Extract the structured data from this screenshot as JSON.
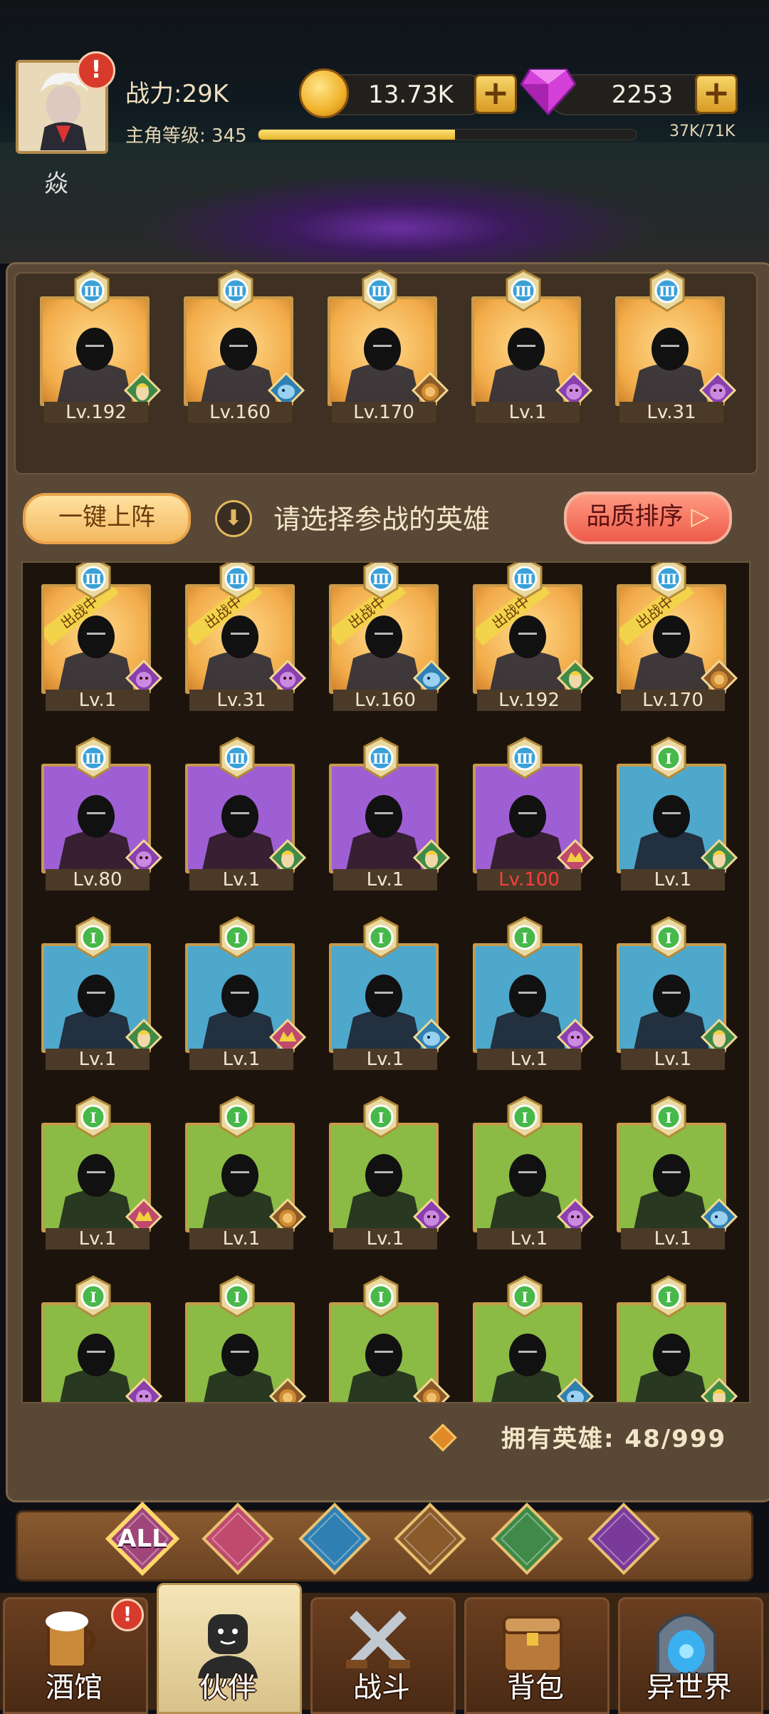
{
  "header": {
    "power": "战力:29K",
    "level_label": "主角等级: 345",
    "exp_text": "37K/71K",
    "exp_progress": 0.52,
    "coins": "13.73K",
    "gems": "2253",
    "fire_icon_text": "焱",
    "alert_mark": "!"
  },
  "team": [
    {
      "level": "Lv.192",
      "rank": "Ⅲ",
      "bg": "gold",
      "faction": "elf-icon",
      "fig": "hooded-rogue"
    },
    {
      "level": "Lv.160",
      "rank": "Ⅲ",
      "bg": "gold",
      "faction": "fish-icon",
      "fig": "mermaid"
    },
    {
      "level": "Lv.170",
      "rank": "Ⅲ",
      "bg": "gold",
      "faction": "lion-icon",
      "fig": "pharaoh"
    },
    {
      "level": "Lv.1",
      "rank": "Ⅲ",
      "bg": "gold",
      "faction": "demon-icon",
      "fig": "spiky-dark-lord"
    },
    {
      "level": "Lv.31",
      "rank": "Ⅲ",
      "bg": "gold",
      "faction": "demon-icon",
      "fig": "purple-ogre"
    }
  ],
  "actions": {
    "auto_deploy": "一键上阵",
    "hint": "请选择参战的英雄",
    "sort": "品质排序",
    "sort_arrow": "▷",
    "hint_arrow": "⬇"
  },
  "heroes": [
    {
      "level": "Lv.1",
      "rank": "Ⅲ",
      "bg": "gold",
      "faction": "demon-icon",
      "tag": "出战中"
    },
    {
      "level": "Lv.31",
      "rank": "Ⅲ",
      "bg": "gold",
      "faction": "demon-icon",
      "tag": "出战中"
    },
    {
      "level": "Lv.160",
      "rank": "Ⅲ",
      "bg": "gold",
      "faction": "fish-icon",
      "tag": "出战中"
    },
    {
      "level": "Lv.192",
      "rank": "Ⅲ",
      "bg": "gold",
      "faction": "elf-icon",
      "tag": "出战中"
    },
    {
      "level": "Lv.170",
      "rank": "Ⅲ",
      "bg": "gold",
      "faction": "lion-icon",
      "tag": "出战中"
    },
    {
      "level": "Lv.80",
      "rank": "Ⅲ",
      "bg": "purple",
      "faction": "demon-icon",
      "tag": ""
    },
    {
      "level": "Lv.1",
      "rank": "Ⅲ",
      "bg": "purple",
      "faction": "elf-icon",
      "tag": ""
    },
    {
      "level": "Lv.1",
      "rank": "Ⅲ",
      "bg": "purple",
      "faction": "elf-icon",
      "tag": ""
    },
    {
      "level": "Lv.100",
      "rank": "Ⅲ",
      "bg": "purple",
      "faction": "human-icon",
      "tag": "",
      "red": true
    },
    {
      "level": "Lv.1",
      "rank": "Ⅰ",
      "bg": "blue",
      "faction": "elf-icon",
      "tag": ""
    },
    {
      "level": "Lv.1",
      "rank": "Ⅰ",
      "bg": "blue",
      "faction": "elf-icon",
      "tag": ""
    },
    {
      "level": "Lv.1",
      "rank": "Ⅰ",
      "bg": "blue",
      "faction": "human-icon",
      "tag": ""
    },
    {
      "level": "Lv.1",
      "rank": "Ⅰ",
      "bg": "blue",
      "faction": "fish-icon",
      "tag": ""
    },
    {
      "level": "Lv.1",
      "rank": "Ⅰ",
      "bg": "blue",
      "faction": "demon-icon",
      "tag": ""
    },
    {
      "level": "Lv.1",
      "rank": "Ⅰ",
      "bg": "blue",
      "faction": "elf-icon",
      "tag": ""
    },
    {
      "level": "Lv.1",
      "rank": "Ⅰ",
      "bg": "green",
      "faction": "human-icon",
      "tag": ""
    },
    {
      "level": "Lv.1",
      "rank": "Ⅰ",
      "bg": "green",
      "faction": "lion-icon",
      "tag": ""
    },
    {
      "level": "Lv.1",
      "rank": "Ⅰ",
      "bg": "green",
      "faction": "demon-icon",
      "tag": ""
    },
    {
      "level": "Lv.1",
      "rank": "Ⅰ",
      "bg": "green",
      "faction": "demon-icon",
      "tag": ""
    },
    {
      "level": "Lv.1",
      "rank": "Ⅰ",
      "bg": "green",
      "faction": "fish-icon",
      "tag": ""
    },
    {
      "level": "",
      "rank": "Ⅰ",
      "bg": "green",
      "faction": "demon-icon",
      "tag": ""
    },
    {
      "level": "",
      "rank": "Ⅰ",
      "bg": "green",
      "faction": "lion-icon",
      "tag": ""
    },
    {
      "level": "",
      "rank": "Ⅰ",
      "bg": "green",
      "faction": "lion-icon",
      "tag": ""
    },
    {
      "level": "",
      "rank": "Ⅰ",
      "bg": "green",
      "faction": "fish-icon",
      "tag": ""
    },
    {
      "level": "",
      "rank": "Ⅰ",
      "bg": "green",
      "faction": "elf-icon",
      "tag": ""
    }
  ],
  "owned": "拥有英雄: 48/999",
  "filters": [
    {
      "name": "all-filter",
      "label": "ALL",
      "color": "#a0457a"
    },
    {
      "name": "human-filter",
      "label": "",
      "color": "#c04a6e"
    },
    {
      "name": "fish-filter",
      "label": "",
      "color": "#2f7fb2"
    },
    {
      "name": "lion-filter",
      "label": "",
      "color": "#8a5a2a"
    },
    {
      "name": "elf-filter",
      "label": "",
      "color": "#3f8a48"
    },
    {
      "name": "demon-filter",
      "label": "",
      "color": "#7a3a9a"
    }
  ],
  "nav": [
    {
      "label": "酒馆",
      "icon": "tavern-beer-icon",
      "alert": "!"
    },
    {
      "label": "伙伴",
      "icon": "partner-icon",
      "active": true
    },
    {
      "label": "战斗",
      "icon": "battle-swords-icon"
    },
    {
      "label": "背包",
      "icon": "backpack-chest-icon"
    },
    {
      "label": "异世界",
      "icon": "portal-icon"
    }
  ],
  "colors": {
    "gold_bg": "#f2ac4a",
    "purple_bg": "#9f5fd4",
    "blue_bg": "#4ea8cc",
    "green_bg": "#8bba45",
    "rank3": "#3aa0d8",
    "rank1": "#47b84a"
  }
}
